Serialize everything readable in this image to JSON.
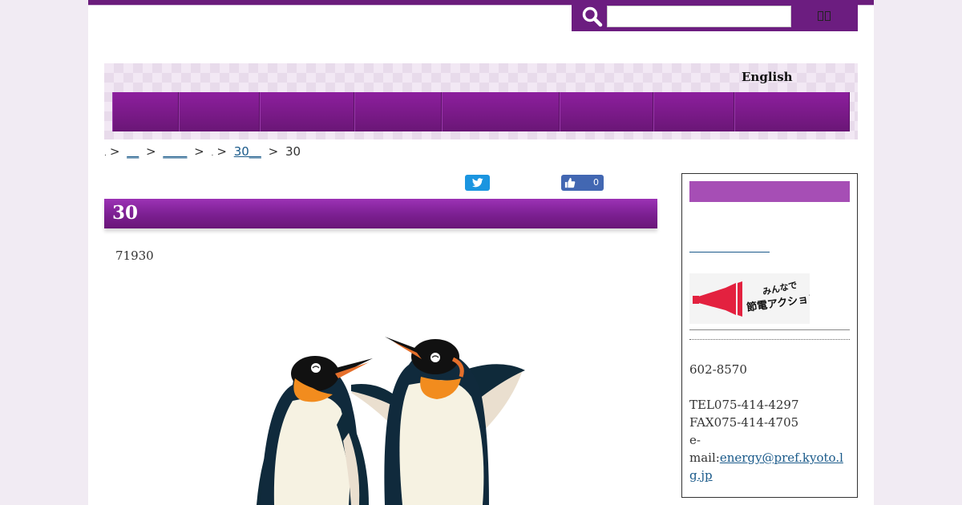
{
  "header": {
    "search_placeholder": "",
    "search_button_label": ""
  },
  "banner": {
    "english_label": "English",
    "nav_items": [
      "",
      "",
      "",
      "",
      "",
      "",
      "",
      ""
    ]
  },
  "breadcrumb": {
    "items": [
      ".",
      "__",
      "____",
      ".",
      "30__",
      "30"
    ]
  },
  "social": {
    "like_count": "0"
  },
  "article": {
    "title": "30",
    "intro": "71930"
  },
  "sidebar": {
    "zip": "602-8570",
    "tel": "TEL075-414-4297",
    "fax": "FAX075-414-4705",
    "email_prefix": "e-",
    "email_label": "mail:",
    "email": "energy@pref.kyoto.lg.jp",
    "banner_text_line1": "みんなで",
    "banner_text_line2": "節電アクション!"
  },
  "colors": {
    "brand_purple": "#6c1d80",
    "nav_purple": "#7b1f91",
    "sidebar_header": "#a64eb5",
    "link_blue": "#1a5a8a",
    "twitter_blue": "#1b95e0",
    "facebook_blue": "#4267b2"
  }
}
